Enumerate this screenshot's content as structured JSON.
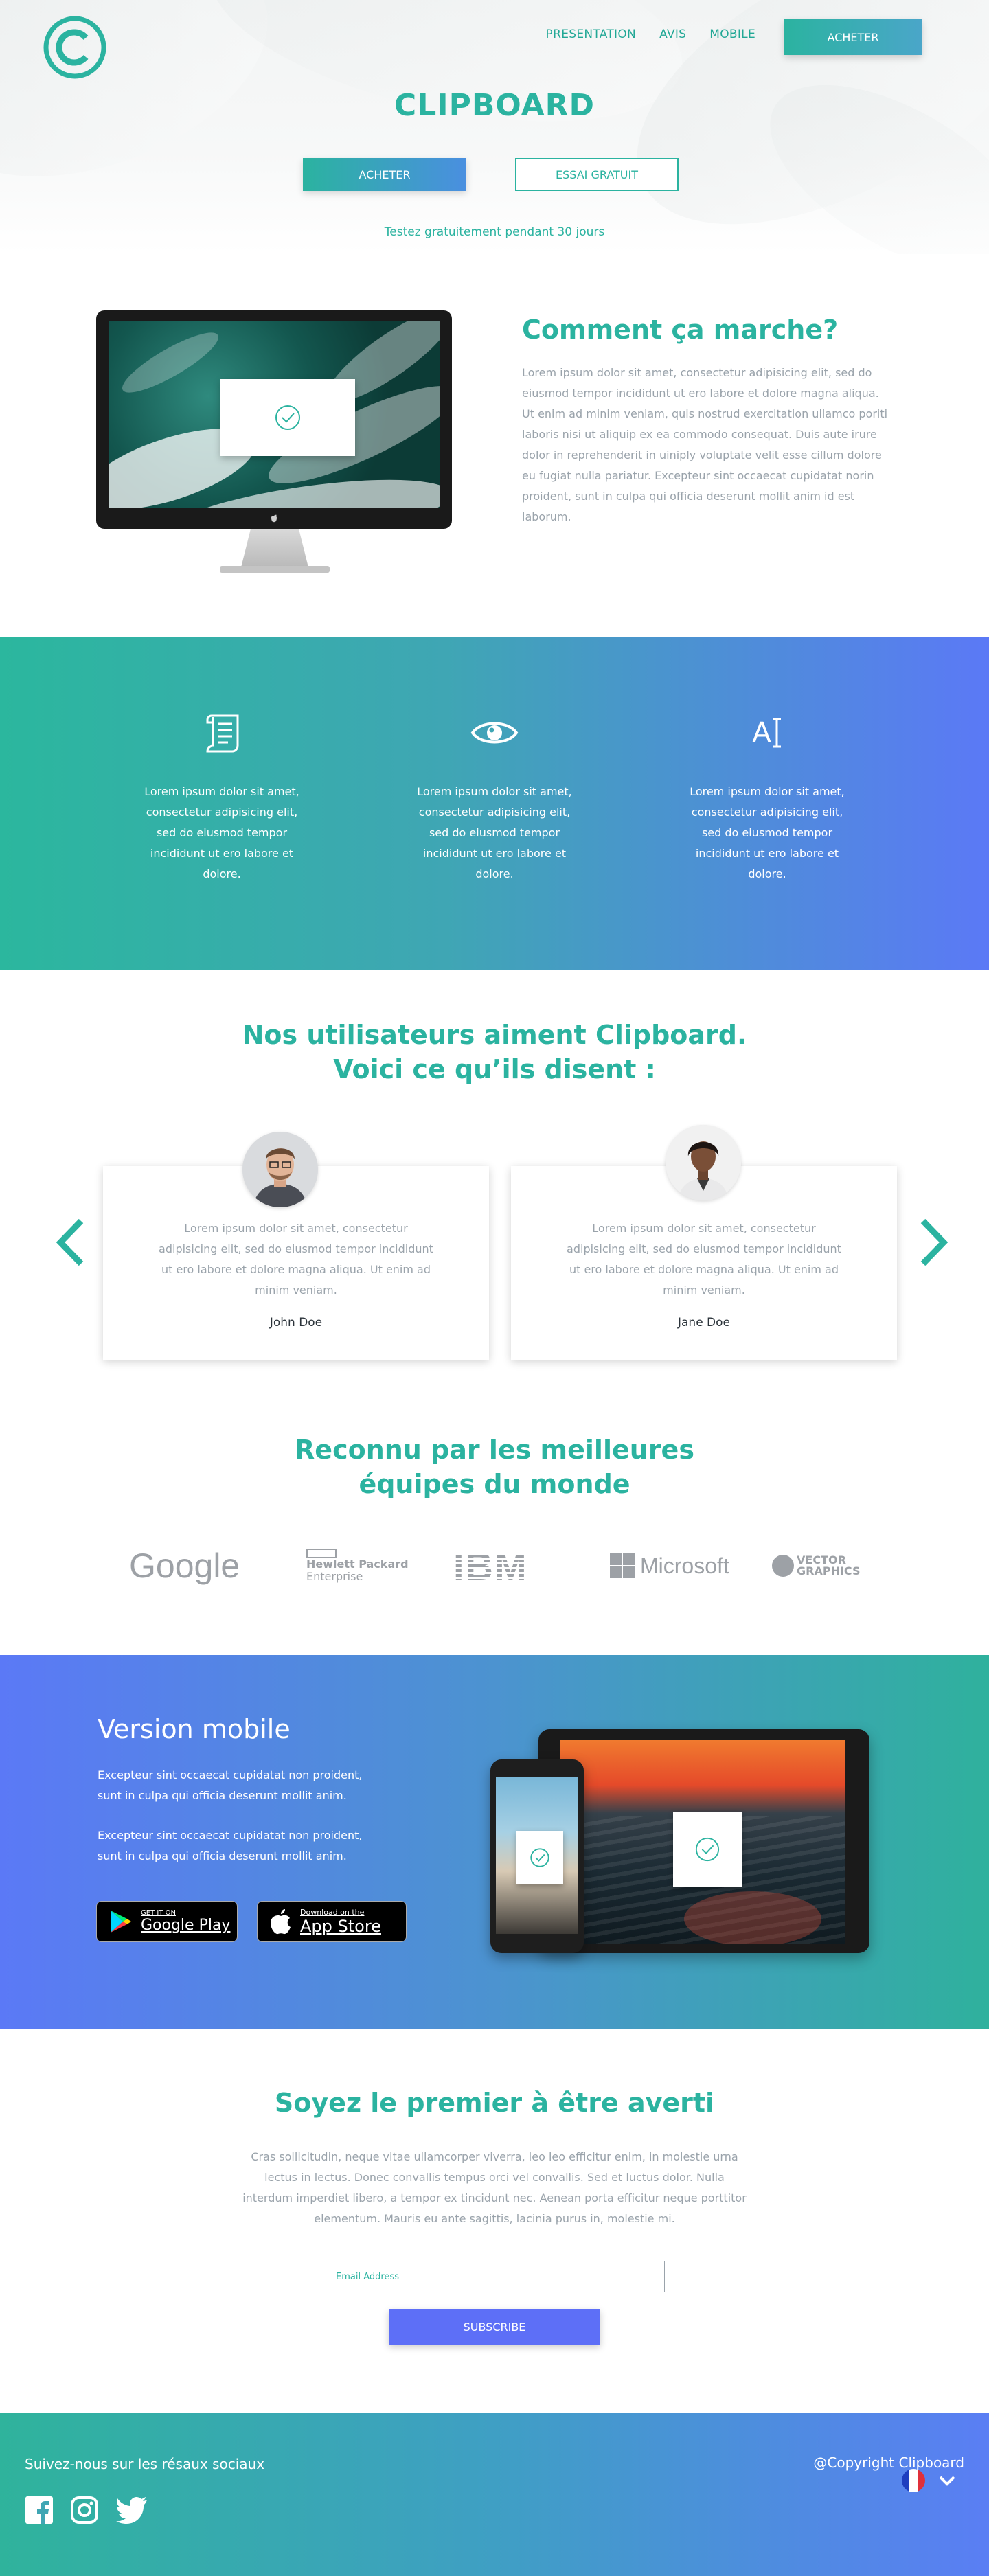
{
  "brand": {
    "logo_letter": "C",
    "accent_color": "#2bb3a0",
    "secondary_color": "#5b79f6"
  },
  "nav": {
    "items": [
      "PRESENTATION",
      "AVIS",
      "MOBILE"
    ],
    "buy_label": "ACHETER"
  },
  "hero": {
    "title": "CLIPBOARD",
    "buy_label": "ACHETER",
    "trial_label": "ESSAI GRATUIT",
    "subtitle": "Testez gratuitement pendant 30 jours"
  },
  "how": {
    "title": "Comment ça marche?",
    "text": "Lorem ipsum dolor sit amet, consectetur adipisicing elit, sed do eiusmod tempor incididunt ut ero labore et dolore magna aliqua. Ut enim ad minim veniam, quis nostrud exercitation ullamco poriti laboris nisi ut aliquip ex ea commodo consequat. Duis aute irure dolor in reprehenderit in uiniply voluptate velit esse cillum dolore eu fugiat nulla pariatur. Excepteur sint occaecat cupidatat norin proident, sunt in culpa qui officia deserunt mollit anim id est laborum."
  },
  "features": [
    {
      "icon": "document-scroll-icon",
      "text": "Lorem ipsum dolor sit amet, consectetur adipisicing elit, sed do eiusmod tempor incididunt ut ero labore et dolore."
    },
    {
      "icon": "eye-icon",
      "text": "Lorem ipsum dolor sit amet, consectetur adipisicing elit, sed do eiusmod tempor incididunt ut ero labore et dolore."
    },
    {
      "icon": "text-cursor-icon",
      "icon_text": "A",
      "text": "Lorem ipsum dolor sit amet, consectetur adipisicing elit, sed do eiusmod tempor incididunt ut ero labore et dolore."
    }
  ],
  "testimonials": {
    "title_line1": "Nos utilisateurs aiment Clipboard.",
    "title_line2": "Voici ce qu’ils disent :",
    "items": [
      {
        "text": "Lorem ipsum dolor sit amet, consectetur adipisicing elit, sed do eiusmod tempor incididunt ut ero labore et dolore magna aliqua. Ut enim ad minim veniam.",
        "name": "John Doe"
      },
      {
        "text": "Lorem ipsum dolor sit amet, consectetur adipisicing elit, sed do eiusmod tempor incididunt ut ero labore et dolore magna aliqua. Ut enim ad minim veniam.",
        "name": "Jane Doe"
      }
    ]
  },
  "brands": {
    "title_line1": "Reconnu par les meilleures",
    "title_line2": "équipes du monde",
    "google": "Google",
    "hp_line1": "Hewlett Packard",
    "hp_line2": "Enterprise",
    "ibm": "IBM",
    "microsoft": "Microsoft",
    "vector_line1": "VECTOR",
    "vector_line2": "GRAPHICS"
  },
  "mobile": {
    "title": "Version mobile",
    "text1": "Excepteur sint occaecat cupidatat non proident, sunt in culpa qui officia deserunt mollit anim.",
    "text2": "Excepteur sint occaecat cupidatat non proident, sunt in culpa qui officia deserunt mollit anim.",
    "google_play_small": "GET IT ON",
    "google_play": "Google Play",
    "app_store_small": "Download on the",
    "app_store": "App Store"
  },
  "newsletter": {
    "title": "Soyez le premier à être averti",
    "text": "Cras sollicitudin, neque vitae ullamcorper viverra, leo leo efficitur enim, in molestie urna lectus in lectus. Donec convallis tempus orci vel convallis. Sed et luctus dolor. Nulla interdum imperdiet libero, a tempor ex tincidunt nec. Aenean porta efficitur neque porttitor elementum. Mauris eu ante sagittis, lacinia purus in, molestie mi.",
    "email_placeholder": "Email Address",
    "subscribe_label": "SUBSCRIBE"
  },
  "footer": {
    "follow": "Suivez-nous sur les résaux sociaux",
    "copyright": "@Copyright Clipboard"
  }
}
